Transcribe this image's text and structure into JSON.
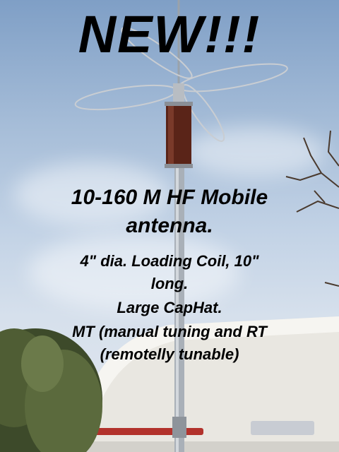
{
  "ad": {
    "headline": "NEW!!!",
    "product_line1": "10-160 M HF Mobile",
    "product_line2": "antenna.",
    "feature1_line1": "4\" dia. Loading Coil, 10\"",
    "feature1_line2": "long.",
    "feature2": "Large CapHat.",
    "feature3_line1": "MT (manual tuning and RT",
    "feature3_line2": "(remotelly tunable)"
  },
  "colors": {
    "text": "#000000",
    "coil": "#5a2418",
    "mast": "#a9b0b8",
    "van": "#eceae4",
    "stripe": "#b2322c"
  }
}
